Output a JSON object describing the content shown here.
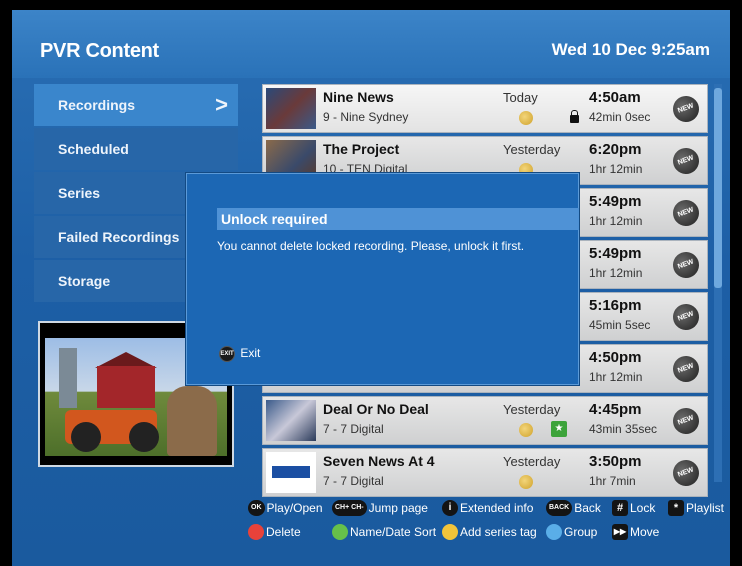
{
  "header": {
    "title": "PVR Content",
    "datetime": "Wed 10 Dec 9:25am"
  },
  "menu": {
    "items": [
      {
        "label": "Recordings",
        "chevron": ">"
      },
      {
        "label": "Scheduled"
      },
      {
        "label": "Series"
      },
      {
        "label": "Failed Recordings"
      },
      {
        "label": "Storage"
      }
    ]
  },
  "recordings": [
    {
      "title": "Nine News",
      "channel": "9 - Nine Sydney",
      "day": "Today",
      "time": "4:50am",
      "duration": "42min 0sec",
      "badge": "NEW",
      "locked": true
    },
    {
      "title": "The Project",
      "channel": "10 - TEN Digital",
      "day": "Yesterday",
      "time": "6:20pm",
      "duration": "1hr 12min",
      "badge": "NEW"
    },
    {
      "title": "",
      "channel": "",
      "day": "",
      "time": "5:49pm",
      "duration": "1hr 12min",
      "badge": "NEW"
    },
    {
      "title": "",
      "channel": "",
      "day": "",
      "time": "5:49pm",
      "duration": "1hr 12min",
      "badge": "NEW"
    },
    {
      "title": "",
      "channel": "",
      "day": "",
      "time": "5:16pm",
      "duration": "45min 5sec",
      "badge": "NEW"
    },
    {
      "title": "",
      "channel": "",
      "day": "",
      "time": "4:50pm",
      "duration": "1hr 12min",
      "badge": "NEW"
    },
    {
      "title": "Deal Or No Deal",
      "channel": "7 - 7 Digital",
      "day": "Yesterday",
      "time": "4:45pm",
      "duration": "43min 35sec",
      "badge": "NEW"
    },
    {
      "title": "Seven News At 4",
      "channel": "7 - 7 Digital",
      "day": "Yesterday",
      "time": "3:50pm",
      "duration": "1hr 7min",
      "badge": "NEW"
    }
  ],
  "dialog": {
    "title": "Unlock required",
    "message": "You cannot delete locked recording. Please, unlock it first.",
    "exit_key": "EXIT",
    "exit_label": "Exit"
  },
  "legend": {
    "play_key": "OK",
    "play": "Play/Open",
    "jump_key": "CH+ CH-",
    "jump": "Jump page",
    "info_key": "i",
    "info": "Extended info",
    "back_key": "BACK",
    "back": "Back",
    "lock_key": "#",
    "lock": "Lock",
    "playlist_key": "*",
    "playlist": "Playlist",
    "delete": "Delete",
    "sort": "Name/Date Sort",
    "series": "Add series tag",
    "group": "Group",
    "move_key": "▶▶",
    "move": "Move"
  },
  "colors": {
    "red": "#e8423a",
    "green": "#66c04a",
    "yellow": "#f2c43a",
    "blue": "#5aaee8"
  }
}
